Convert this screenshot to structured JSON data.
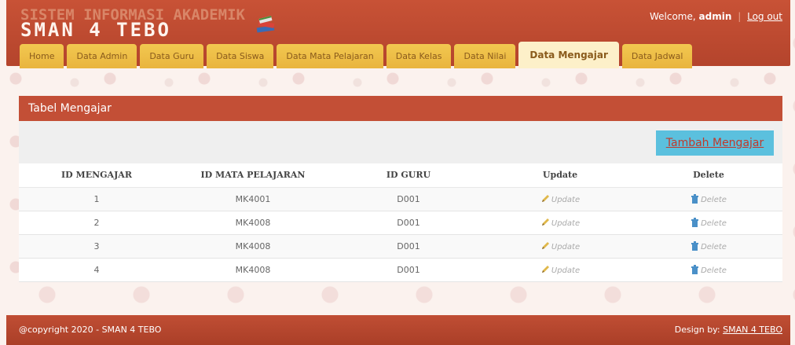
{
  "header": {
    "title_line1": "SISTEM INFORMASI AKADEMIK",
    "title_line2": "SMAN 4 TEBO",
    "welcome_prefix": "Welcome,",
    "username": "admin",
    "separator": "|",
    "logout": "Log out",
    "logo_icon": "books-icon"
  },
  "nav": {
    "tabs": [
      {
        "label": "Home"
      },
      {
        "label": "Data Admin"
      },
      {
        "label": "Data Guru"
      },
      {
        "label": "Data Siswa"
      },
      {
        "label": "Data Mata Pelajaran"
      },
      {
        "label": "Data Kelas"
      },
      {
        "label": "Data Nilai"
      },
      {
        "label": "Data Mengajar",
        "active": true
      },
      {
        "label": "Data Jadwal"
      }
    ]
  },
  "panel": {
    "title": "Tabel Mengajar",
    "add_button": "Tambah Mengajar"
  },
  "table": {
    "columns": [
      "ID MENGAJAR",
      "ID MATA PELAJARAN",
      "ID GURU",
      "Update",
      "Delete"
    ],
    "rows": [
      {
        "id": "1",
        "mapel": "MK4001",
        "guru": "D001",
        "update": "Update",
        "delete": "Delete"
      },
      {
        "id": "2",
        "mapel": "MK4008",
        "guru": "D001",
        "update": "Update",
        "delete": "Delete"
      },
      {
        "id": "3",
        "mapel": "MK4008",
        "guru": "D001",
        "update": "Update",
        "delete": "Delete"
      },
      {
        "id": "4",
        "mapel": "MK4008",
        "guru": "D001",
        "update": "Update",
        "delete": "Delete"
      }
    ]
  },
  "footer": {
    "copyright": "@copyright 2020 - SMAN 4 TEBO",
    "design_prefix": "Design by:",
    "design_link": "SMAN 4 TEBO"
  },
  "colors": {
    "header": "#c34f36",
    "tab": "#eebd45",
    "tab_active": "#fdf0c9",
    "add_button": "#5bc0de"
  }
}
